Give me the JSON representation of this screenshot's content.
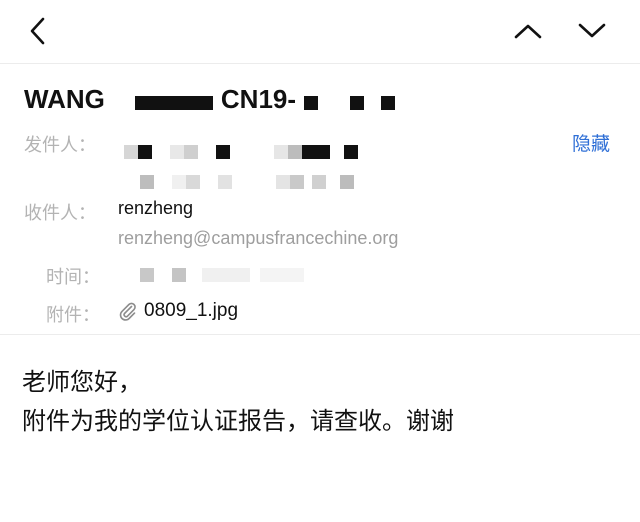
{
  "nav": {
    "back_icon": "chevron-left-icon",
    "prev_icon": "chevron-up-icon",
    "next_icon": "chevron-down-icon"
  },
  "subject": {
    "prefix": "WANG",
    "middle": "CN19-"
  },
  "header": {
    "sender_label": "发件人：",
    "hide_label": "隐藏",
    "recipient_label": "收件人：",
    "recipient_name": "renzheng",
    "recipient_email": "renzheng@campusfrancechine.org",
    "time_label": "时间：",
    "attachment_label": "附件：",
    "attachment_icon": "paperclip-icon",
    "attachment_name": "0809_1.jpg"
  },
  "body": {
    "line1": "老师您好，",
    "line2": "附件为我的学位认证报告，请查收。谢谢"
  }
}
